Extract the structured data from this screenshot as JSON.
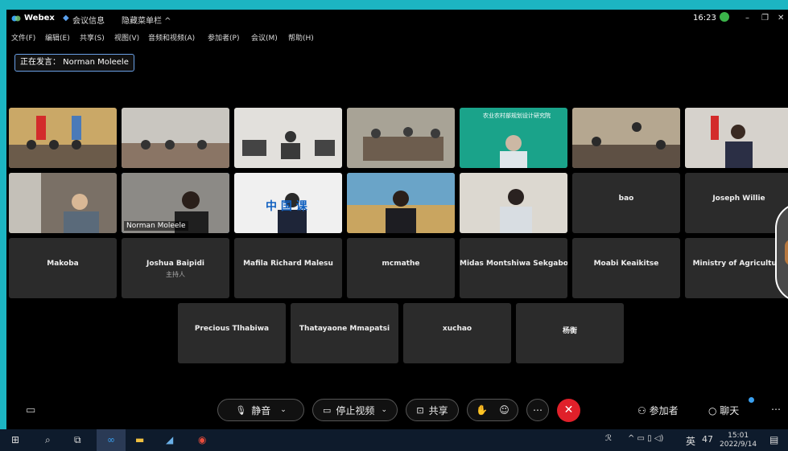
{
  "title_bar": {
    "app_name": "Webex",
    "meeting_info": "会议信息",
    "hide_menu": "隐藏菜单栏 ^",
    "time": "16:23"
  },
  "menu": [
    "文件(F)",
    "编辑(E)",
    "共享(S)",
    "视图(V)",
    "音频和视频(A)",
    "参加者(P)",
    "会议(M)",
    "帮助(H)"
  ],
  "speaker_label": "正在发言： Norman Moleele",
  "video_tiles": [
    {
      "id": "v1"
    },
    {
      "id": "v2"
    },
    {
      "id": "v3"
    },
    {
      "id": "v4"
    },
    {
      "id": "v5",
      "overlay": "农业农村部规划设计研究院"
    },
    {
      "id": "v6"
    },
    {
      "id": "v7"
    },
    {
      "id": "v8"
    },
    {
      "id": "v9",
      "overlay": "Norman Moleele"
    },
    {
      "id": "v10",
      "overlay": "中 国 课"
    },
    {
      "id": "v11"
    },
    {
      "id": "v12"
    }
  ],
  "name_tiles": [
    {
      "name": "bao"
    },
    {
      "name": "Joseph Willie"
    },
    {
      "name": "Makoba"
    },
    {
      "name": "Joshua Baipidi",
      "role": "主持人"
    },
    {
      "name": "Mafila Richard Malesu"
    },
    {
      "name": "mcmathe"
    },
    {
      "name": "Midas Montshiwa Sekgabo"
    },
    {
      "name": "Moabi Keaikitse"
    },
    {
      "name": "Ministry of Agriculture"
    },
    {
      "name": "Precious Tlhabiwa"
    },
    {
      "name": "Thatayaone Mmapatsi"
    },
    {
      "name": "xuchao"
    },
    {
      "name": "杨衡"
    }
  ],
  "controls": {
    "mute": "静音",
    "stop_video": "停止视频",
    "share": "共享",
    "participants": "参加者",
    "chat": "聊天"
  },
  "taskbar": {
    "time": "15:01",
    "date": "2022/9/14",
    "ime": "英",
    "temp": "47"
  },
  "colors": {
    "accent": "#5aa0ee",
    "end_call": "#e0202a",
    "tile": "#2b2b2b"
  }
}
